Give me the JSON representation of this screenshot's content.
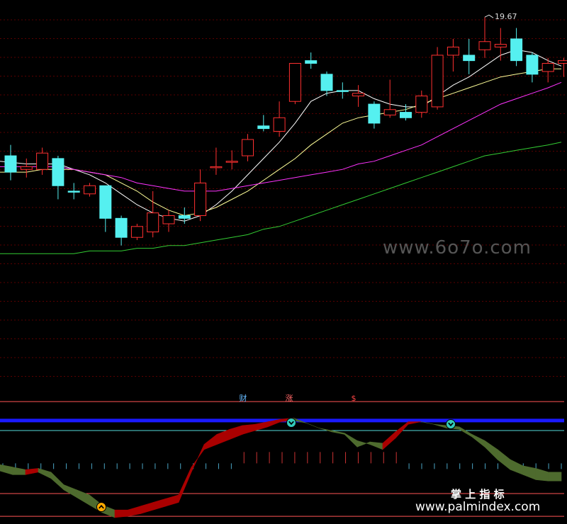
{
  "chart_data": {
    "type": "candlestick",
    "price": {
      "ylim": [
        9.6,
        20.2
      ],
      "peak_label": "19.67",
      "candles": [
        {
          "o": 14.6,
          "h": 15.0,
          "l": 13.7,
          "c": 14.0,
          "color": "#55f0f0"
        },
        {
          "o": 14.1,
          "h": 14.5,
          "l": 13.8,
          "c": 14.2,
          "color": "#ff3030"
        },
        {
          "o": 14.1,
          "h": 14.9,
          "l": 13.9,
          "c": 14.7,
          "color": "#ff3030"
        },
        {
          "o": 14.5,
          "h": 14.6,
          "l": 13.0,
          "c": 13.5,
          "color": "#55f0f0"
        },
        {
          "o": 13.3,
          "h": 13.6,
          "l": 13.0,
          "c": 13.3,
          "color": "#55f0f0"
        },
        {
          "o": 13.2,
          "h": 13.6,
          "l": 13.1,
          "c": 13.5,
          "color": "#ff3030"
        },
        {
          "o": 13.5,
          "h": 13.5,
          "l": 11.8,
          "c": 12.3,
          "color": "#55f0f0"
        },
        {
          "o": 12.3,
          "h": 12.4,
          "l": 11.3,
          "c": 11.6,
          "color": "#55f0f0"
        },
        {
          "o": 11.6,
          "h": 12.1,
          "l": 11.5,
          "c": 12.0,
          "color": "#ff3030"
        },
        {
          "o": 11.8,
          "h": 13.3,
          "l": 11.6,
          "c": 12.5,
          "color": "#ff3030"
        },
        {
          "o": 12.1,
          "h": 12.6,
          "l": 11.8,
          "c": 12.4,
          "color": "#ff3030"
        },
        {
          "o": 12.4,
          "h": 12.7,
          "l": 12.1,
          "c": 12.3,
          "color": "#55f0f0"
        },
        {
          "o": 12.4,
          "h": 14.1,
          "l": 12.2,
          "c": 13.6,
          "color": "#ff3030"
        },
        {
          "o": 14.2,
          "h": 14.9,
          "l": 13.9,
          "c": 14.2,
          "color": "#ff3030"
        },
        {
          "o": 14.4,
          "h": 14.8,
          "l": 14.1,
          "c": 14.4,
          "color": "#ff3030"
        },
        {
          "o": 14.6,
          "h": 15.4,
          "l": 14.4,
          "c": 15.2,
          "color": "#ff3030"
        },
        {
          "o": 15.7,
          "h": 16.1,
          "l": 15.5,
          "c": 15.6,
          "color": "#55f0f0"
        },
        {
          "o": 15.5,
          "h": 16.6,
          "l": 15.3,
          "c": 16.0,
          "color": "#ff3030"
        },
        {
          "o": 16.6,
          "h": 17.9,
          "l": 16.5,
          "c": 18.0,
          "color": "#ff3030"
        },
        {
          "o": 18.1,
          "h": 18.4,
          "l": 17.8,
          "c": 18.0,
          "color": "#55f0f0"
        },
        {
          "o": 17.6,
          "h": 17.7,
          "l": 16.8,
          "c": 17.0,
          "color": "#55f0f0"
        },
        {
          "o": 17.0,
          "h": 17.3,
          "l": 16.7,
          "c": 17.0,
          "color": "#55f0f0"
        },
        {
          "o": 16.8,
          "h": 17.2,
          "l": 16.4,
          "c": 16.9,
          "color": "#ff3030"
        },
        {
          "o": 16.5,
          "h": 16.6,
          "l": 15.6,
          "c": 15.8,
          "color": "#55f0f0"
        },
        {
          "o": 16.1,
          "h": 17.4,
          "l": 16.0,
          "c": 16.3,
          "color": "#ff3030"
        },
        {
          "o": 16.2,
          "h": 16.5,
          "l": 15.9,
          "c": 16.0,
          "color": "#55f0f0"
        },
        {
          "o": 16.2,
          "h": 17.0,
          "l": 16.0,
          "c": 16.8,
          "color": "#ff3030"
        },
        {
          "o": 16.4,
          "h": 18.6,
          "l": 16.3,
          "c": 18.3,
          "color": "#ff3030"
        },
        {
          "o": 18.3,
          "h": 18.9,
          "l": 17.7,
          "c": 18.6,
          "color": "#ff3030"
        },
        {
          "o": 18.3,
          "h": 18.9,
          "l": 17.6,
          "c": 18.1,
          "color": "#55f0f0"
        },
        {
          "o": 18.5,
          "h": 19.7,
          "l": 18.2,
          "c": 18.8,
          "color": "#ff3030"
        },
        {
          "o": 18.7,
          "h": 19.3,
          "l": 18.1,
          "c": 18.6,
          "color": "#ff3030"
        },
        {
          "o": 18.9,
          "h": 19.3,
          "l": 17.9,
          "c": 18.1,
          "color": "#55f0f0"
        },
        {
          "o": 18.3,
          "h": 18.4,
          "l": 17.3,
          "c": 17.6,
          "color": "#55f0f0"
        },
        {
          "o": 17.7,
          "h": 18.2,
          "l": 17.3,
          "c": 18.0,
          "color": "#ff3030"
        },
        {
          "o": 18.0,
          "h": 18.2,
          "l": 17.5,
          "c": 18.1,
          "color": "#ff3030"
        }
      ],
      "ma": [
        {
          "color": "#ffffff",
          "values": [
            14.4,
            14.3,
            14.3,
            14.3,
            14.1,
            13.9,
            13.6,
            13.2,
            12.8,
            12.5,
            12.3,
            12.2,
            12.4,
            12.8,
            13.3,
            13.9,
            14.5,
            15.1,
            15.8,
            16.6,
            16.9,
            17.0,
            17.0,
            16.7,
            16.5,
            16.4,
            16.4,
            16.8,
            17.2,
            17.5,
            17.9,
            18.3,
            18.5,
            18.4,
            18.1,
            17.9
          ]
        },
        {
          "color": "#ffff99",
          "values": [
            14.0,
            14.0,
            14.1,
            14.1,
            14.1,
            14.0,
            13.9,
            13.6,
            13.3,
            12.9,
            12.6,
            12.4,
            12.5,
            12.7,
            13.0,
            13.3,
            13.7,
            14.1,
            14.5,
            15.0,
            15.4,
            15.8,
            16.0,
            16.1,
            16.2,
            16.3,
            16.5,
            16.7,
            16.9,
            17.1,
            17.3,
            17.5,
            17.6,
            17.7,
            17.8,
            17.8
          ]
        },
        {
          "color": "#ff33ff",
          "values": [
            14.2,
            14.2,
            14.2,
            14.2,
            14.1,
            14.0,
            13.9,
            13.8,
            13.6,
            13.5,
            13.4,
            13.3,
            13.3,
            13.3,
            13.4,
            13.5,
            13.6,
            13.7,
            13.8,
            13.9,
            14.0,
            14.1,
            14.3,
            14.4,
            14.6,
            14.8,
            15.0,
            15.3,
            15.6,
            15.9,
            16.2,
            16.5,
            16.7,
            16.9,
            17.1,
            17.3
          ]
        },
        {
          "color": "#33cc33",
          "values": [
            11.0,
            11.0,
            11.0,
            11.0,
            11.0,
            11.1,
            11.1,
            11.1,
            11.2,
            11.2,
            11.3,
            11.3,
            11.4,
            11.5,
            11.6,
            11.7,
            11.9,
            12.0,
            12.2,
            12.4,
            12.6,
            12.8,
            13.0,
            13.2,
            13.4,
            13.6,
            13.8,
            14.0,
            14.2,
            14.4,
            14.6,
            14.7,
            14.8,
            14.9,
            15.0,
            15.1
          ]
        }
      ]
    },
    "indicator": {
      "ylim": [
        0,
        100
      ],
      "levels": [
        {
          "y": 96,
          "color": "#ff5555",
          "width": 1
        },
        {
          "y": 81,
          "color": "#1a1aff",
          "width": 5
        },
        {
          "y": 73,
          "color": "#55dddd",
          "width": 1
        },
        {
          "y": 23,
          "color": "#ff5555",
          "width": 1
        },
        {
          "y": 5,
          "color": "#ff5555",
          "width": 1
        }
      ],
      "zero_line": 47,
      "upper": [
        41,
        38,
        38,
        40,
        35,
        26,
        20,
        14,
        8,
        4,
        5,
        7,
        10,
        13,
        16,
        40,
        62,
        70,
        74,
        77,
        78,
        80,
        82,
        83,
        79,
        75,
        73,
        71,
        65,
        62,
        58,
        67,
        78,
        80,
        78,
        75,
        74,
        68,
        60,
        50,
        42,
        38,
        34,
        33,
        33
      ],
      "lower": [
        46,
        44,
        42,
        43,
        40,
        30,
        26,
        22,
        14,
        10,
        10,
        13,
        16,
        19,
        22,
        44,
        58,
        62,
        66,
        70,
        73,
        76,
        80,
        81,
        79,
        75,
        72,
        70,
        60,
        64,
        63,
        72,
        80,
        80,
        78,
        77,
        76,
        70,
        65,
        58,
        50,
        45,
        43,
        40,
        40
      ],
      "band_colors": {
        "up": "#aa0000",
        "down": "#4e6b2e"
      },
      "ticks": [
        0,
        0,
        0,
        0,
        0,
        0,
        0,
        0,
        0,
        0,
        0,
        0,
        0,
        0,
        0,
        0,
        0,
        0,
        0,
        1,
        1,
        1,
        1,
        1,
        1,
        1,
        1,
        1,
        1,
        1,
        1,
        1,
        0,
        0,
        0,
        0,
        0,
        0,
        0,
        0,
        0,
        0,
        0,
        0,
        0
      ],
      "labels": [
        "财",
        "涨",
        "$"
      ],
      "label_colors": [
        "#66bbff",
        "#ff6666",
        "#ff4444"
      ]
    }
  },
  "watermark": {
    "site": "www.6o7o.com",
    "brand_cn": "掌 上 指 标",
    "brand_url": "www.palmindex.com"
  }
}
